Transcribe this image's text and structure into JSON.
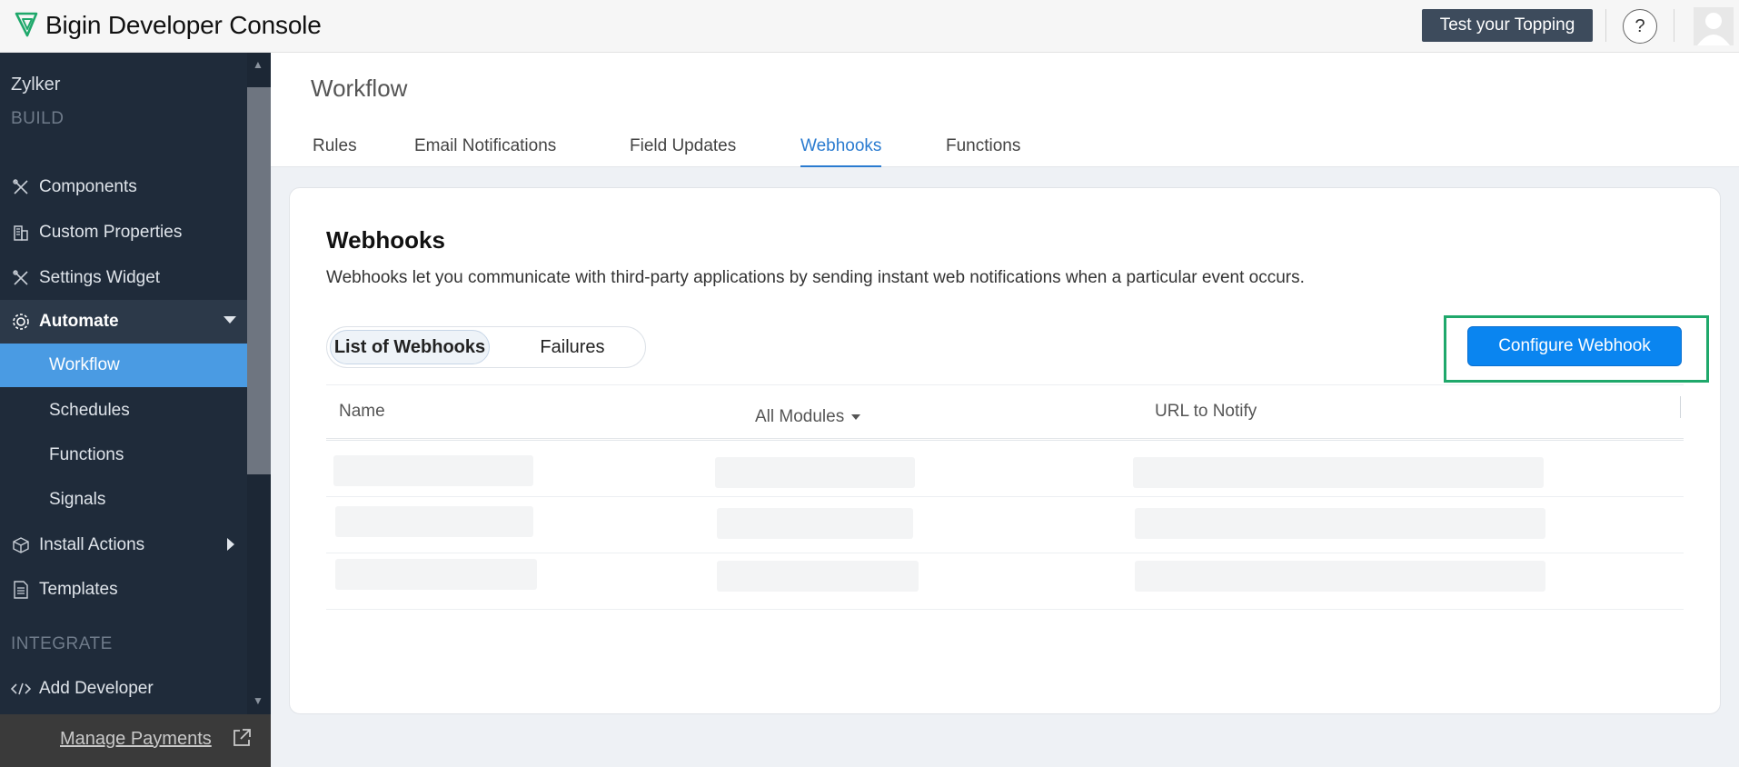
{
  "header": {
    "app_title": "Bigin Developer Console",
    "test_button": "Test your Topping",
    "help_label": "?",
    "brand_color": "#1fa86b"
  },
  "sidebar": {
    "workspace": "Zylker",
    "sections": {
      "build": "BUILD",
      "integrate": "INTEGRATE"
    },
    "items": {
      "components": "Components",
      "custom_properties": "Custom Properties",
      "settings_widget": "Settings Widget",
      "automate": "Automate",
      "workflow": "Workflow",
      "schedules": "Schedules",
      "functions": "Functions",
      "signals": "Signals",
      "install_actions": "Install Actions",
      "templates": "Templates",
      "add_developer": "Add Developer"
    },
    "footer": "Manage Payments"
  },
  "main": {
    "page_title": "Workflow",
    "tabs": {
      "rules": "Rules",
      "email_notifications": "Email Notifications",
      "field_updates": "Field Updates",
      "webhooks": "Webhooks",
      "functions": "Functions"
    },
    "active_tab": "Webhooks",
    "card": {
      "title": "Webhooks",
      "description": "Webhooks let you communicate with third-party applications by sending instant web notifications when a particular event occurs.",
      "toggle": {
        "list": "List of Webhooks",
        "failures": "Failures"
      },
      "configure_button": "Configure Webhook",
      "table": {
        "col_name": "Name",
        "col_modules": "All Modules",
        "col_url": "URL to Notify"
      }
    }
  }
}
